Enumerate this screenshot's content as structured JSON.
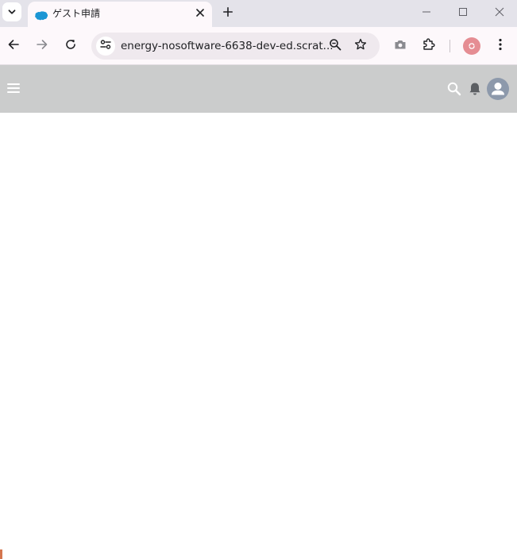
{
  "browser": {
    "tab": {
      "title": "ゲスト申請",
      "favicon": "salesforce-cloud-icon"
    },
    "address_bar": {
      "url": "energy-nosoftware-6638-dev-ed.scrat..."
    },
    "toolbar_icons": [
      "back-icon",
      "forward-icon",
      "reload-icon",
      "site-info-icon",
      "zoom-icon",
      "bookmark-star-icon",
      "camera-icon",
      "extensions-icon",
      "profile-icon",
      "menu-icon"
    ],
    "window_controls": [
      "minimize-icon",
      "maximize-icon",
      "close-icon"
    ]
  },
  "app_header": {
    "icons": [
      "hamburger-menu-icon",
      "search-icon",
      "notification-bell-icon",
      "user-avatar-icon"
    ],
    "background": "#cbcccc"
  },
  "colors": {
    "tab_active": "#fdf8fb",
    "tabstrip": "#e4e3ea",
    "profile_accent": "#e58d93",
    "avatar": "#8d99ab",
    "corner_mark": "#d4764e"
  }
}
